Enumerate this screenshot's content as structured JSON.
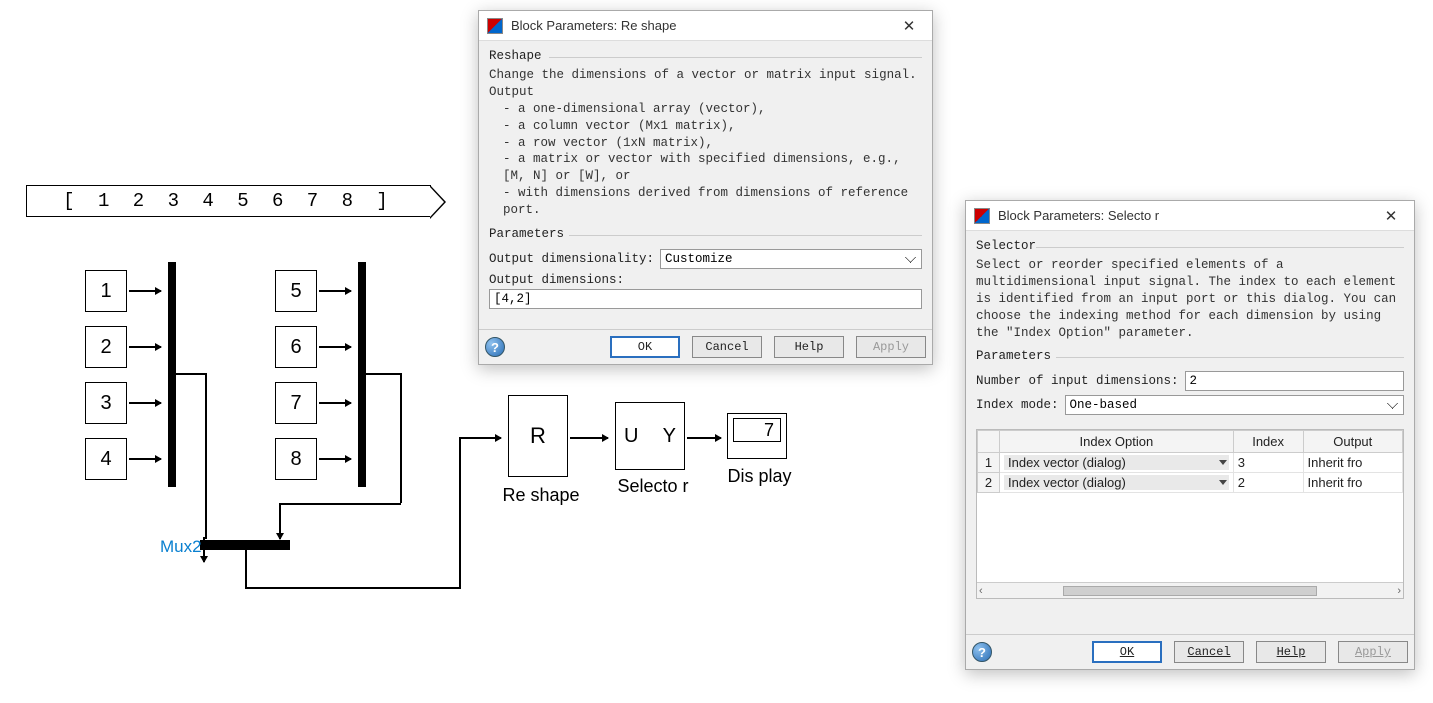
{
  "source_tag_text": "[ 1 2 3 4 5 6 7 8 ]",
  "mux_label": "Mux2",
  "stackA": [
    "1",
    "2",
    "3",
    "4"
  ],
  "stackB": [
    "5",
    "6",
    "7",
    "8"
  ],
  "reshape_block": {
    "letter": "R",
    "label": "Re shape"
  },
  "selector_block": {
    "u": "U",
    "y": "Y",
    "label": "Selecto r"
  },
  "display_block": {
    "value": "7",
    "label": "Dis play"
  },
  "dlg1": {
    "title": "Block Parameters: Re shape",
    "group1": "Reshape",
    "desc_line1": "Change the dimensions of a vector or matrix input signal. Output",
    "desc_b1": "- a one-dimensional array (vector),",
    "desc_b2": "- a column vector (Mx1 matrix),",
    "desc_b3": "- a row vector (1xN matrix),",
    "desc_b4": "- a matrix or vector with specified dimensions, e.g., [M, N] or [W], or",
    "desc_b5": "- with dimensions derived from dimensions of reference port.",
    "group2": "Parameters",
    "outdim_label": "Output dimensionality:",
    "outdim_value": "Customize",
    "outdims_label": "Output dimensions:",
    "outdims_value": "[4,2]",
    "btn_ok": "OK",
    "btn_cancel": "Cancel",
    "btn_help": "Help",
    "btn_apply": "Apply"
  },
  "dlg2": {
    "title": "Block Parameters: Selecto r",
    "group1": "Selector",
    "desc": "Select or reorder specified elements of a multidimensional input signal. The index to each element is identified from an input port or this dialog. You can choose the indexing method for each dimension by using the \"Index Option\" parameter.",
    "group2": "Parameters",
    "numdims_label": "Number of input dimensions:",
    "numdims_value": "2",
    "idxmode_label": "Index mode:",
    "idxmode_value": "One-based",
    "th_option": "Index Option",
    "th_index": "Index",
    "th_output": "Output",
    "rows": [
      {
        "n": "1",
        "opt": "Index vector (dialog)",
        "idx": "3",
        "out": "Inherit fro"
      },
      {
        "n": "2",
        "opt": "Index vector (dialog)",
        "idx": "2",
        "out": "Inherit fro"
      }
    ],
    "btn_ok": "OK",
    "btn_cancel": "Cancel",
    "btn_help": "Help",
    "btn_apply": "Apply"
  }
}
